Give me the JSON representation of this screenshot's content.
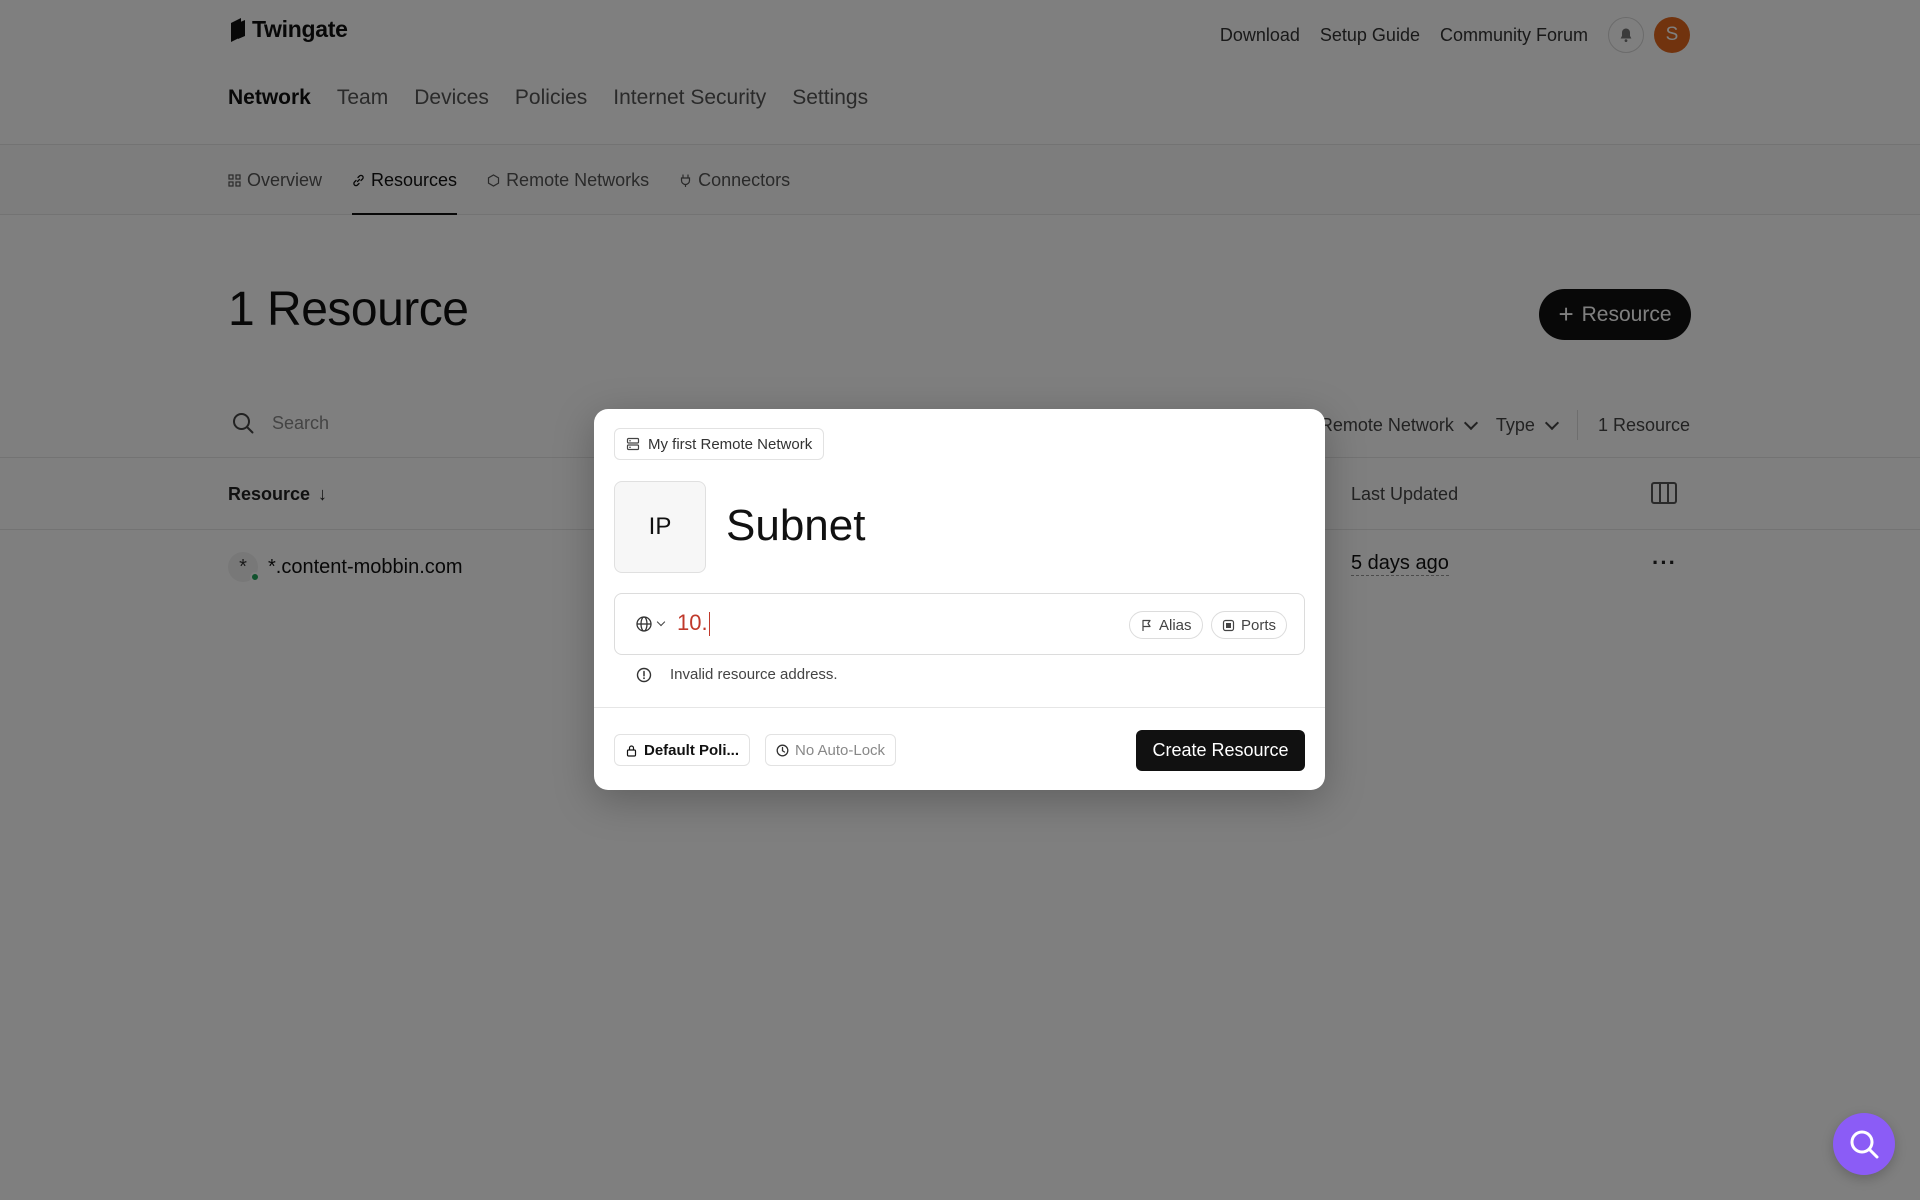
{
  "brand": {
    "name": "Twingate"
  },
  "top_links": {
    "download": "Download",
    "setup_guide": "Setup Guide",
    "community_forum": "Community Forum"
  },
  "user": {
    "avatar_initial": "S",
    "avatar_color": "#e2661c"
  },
  "primary_nav": [
    "Network",
    "Team",
    "Devices",
    "Policies",
    "Internet Security",
    "Settings"
  ],
  "secondary_nav": [
    "Overview",
    "Resources",
    "Remote Networks",
    "Connectors"
  ],
  "page": {
    "heading": "1 Resource",
    "add_button": "Resource"
  },
  "search": {
    "placeholder": "Search"
  },
  "filters": {
    "remote_network": "Remote Network",
    "type": "Type",
    "count": "1 Resource"
  },
  "table": {
    "headers": {
      "resource": "Resource",
      "last_updated": "Last Updated"
    },
    "rows": [
      {
        "avatar": "*",
        "name": "*.content-mobbin.com",
        "last_updated": "5 days ago",
        "status_color": "#22a55b"
      }
    ]
  },
  "modal": {
    "remote_network": "My first Remote Network",
    "type_tile": "IP",
    "title": "Subnet",
    "address_value": "10.",
    "alias_label": "Alias",
    "ports_label": "Ports",
    "error_text": "Invalid resource address.",
    "policy_label": "Default Poli...",
    "autolock_label": "No Auto-Lock",
    "create_button": "Create Resource"
  },
  "colors": {
    "accent": "#111111",
    "error": "#c0392b",
    "chat": "#8b5cf6"
  }
}
